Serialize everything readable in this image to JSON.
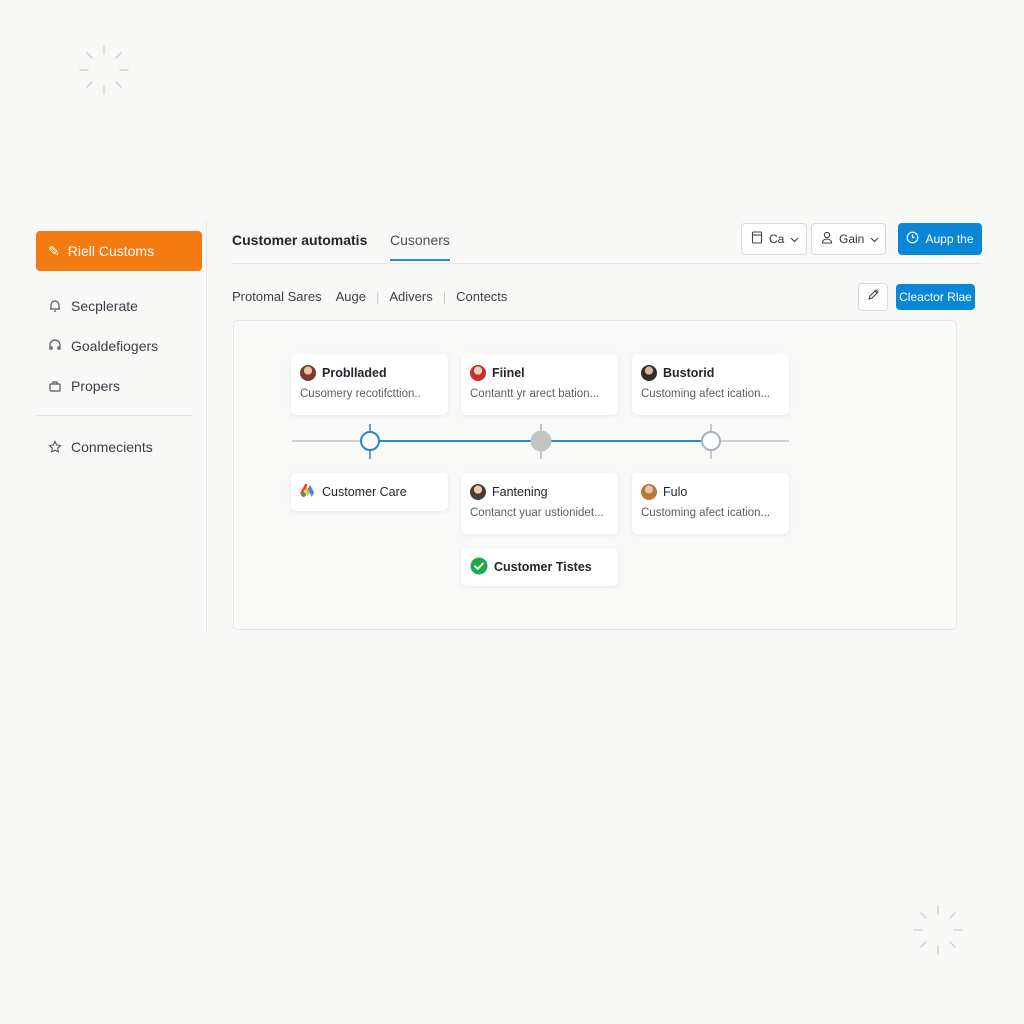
{
  "sidebar": {
    "primary_button": "Riell Customs",
    "items": [
      {
        "label": "Secplerate",
        "icon": "bell-icon"
      },
      {
        "label": "Goaldefiogers",
        "icon": "headset-icon"
      },
      {
        "label": "Propers",
        "icon": "briefcase-icon"
      },
      {
        "label": "Conmecients",
        "icon": "star-icon"
      }
    ]
  },
  "header": {
    "tabs": [
      "Customer automatis",
      "Cusoners"
    ],
    "active_tab": 1,
    "ca_button": "Ca",
    "gain_button": "Gain",
    "apply_button": "Aupp the"
  },
  "filters": {
    "items": [
      "Protomal Sares",
      "Auge",
      "Adivers",
      "Contects"
    ],
    "create_button": "Cleactor Rlae"
  },
  "cards": {
    "top": [
      {
        "title": "Problladed",
        "sub": "Cusomery recotifcttion.."
      },
      {
        "title": "Fiinel",
        "sub": "Contantt yr arect bation..."
      },
      {
        "title": "Bustorid",
        "sub": "Customing afect ication..."
      }
    ],
    "bottom": [
      {
        "title": "Customer Care"
      },
      {
        "title": "Fantening",
        "sub": "Contanct yuar ustionidet..."
      },
      {
        "title": "Fulo",
        "sub": "Customing afect ication..."
      }
    ],
    "extra": {
      "title": "Customer Tistes"
    }
  },
  "colors": {
    "accent_orange": "#f47a12",
    "accent_blue": "#0a86d6",
    "timeline_blue": "#2a86cc",
    "success_green": "#1faa4a"
  }
}
